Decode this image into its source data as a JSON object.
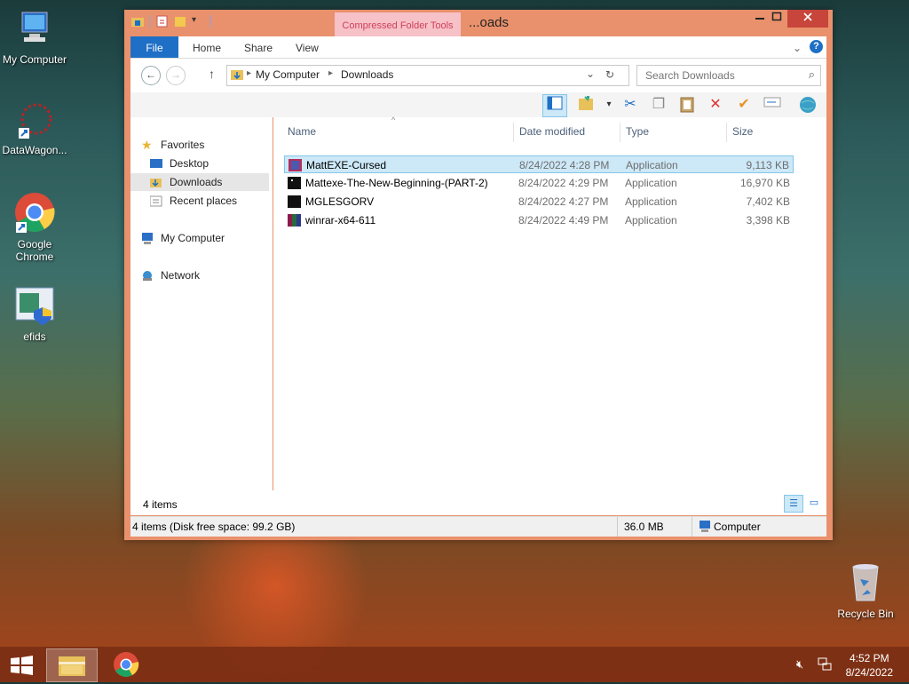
{
  "desktop": {
    "icons": [
      {
        "label": "My Computer",
        "icon": "computer-icon"
      },
      {
        "label": "DataWagon...",
        "icon": "datawagon-icon"
      },
      {
        "label": "Google Chrome",
        "icon": "chrome-icon"
      },
      {
        "label": "efids",
        "icon": "efids-icon"
      },
      {
        "label": "Recycle Bin",
        "icon": "recycle-bin-icon"
      }
    ]
  },
  "window": {
    "title": "...oads",
    "context_tab": "Compressed Folder Tools",
    "ribbon_tabs": [
      "File",
      "Home",
      "Share",
      "View"
    ],
    "breadcrumb": [
      "My Computer",
      "Downloads"
    ],
    "search_placeholder": "Search Downloads",
    "accent": "#1e6fc5",
    "frame_color": "#e9916c"
  },
  "nav": {
    "favorites": "Favorites",
    "desktop": "Desktop",
    "downloads": "Downloads",
    "recent": "Recent places",
    "my_computer": "My Computer",
    "network": "Network"
  },
  "columns": {
    "name": "Name",
    "date": "Date modified",
    "type": "Type",
    "size": "Size"
  },
  "files": [
    {
      "name": "MattEXE-Cursed",
      "date": "8/24/2022 4:28 PM",
      "type": "Application",
      "size": "9,113 KB"
    },
    {
      "name": "Mattexe-The-New-Beginning-(PART-2)",
      "date": "8/24/2022 4:29 PM",
      "type": "Application",
      "size": "16,970 KB"
    },
    {
      "name": "MGLESGORV",
      "date": "8/24/2022 4:27 PM",
      "type": "Application",
      "size": "7,402 KB"
    },
    {
      "name": "winrar-x64-611",
      "date": "8/24/2022 4:49 PM",
      "type": "Application",
      "size": "3,398 KB"
    }
  ],
  "status": {
    "item_count": "4 items",
    "free_space": "4 items (Disk free space: 99.2 GB)",
    "total_size": "36.0 MB",
    "location": "Computer"
  },
  "taskbar": {
    "time": "4:52 PM",
    "date": "8/24/2022"
  }
}
